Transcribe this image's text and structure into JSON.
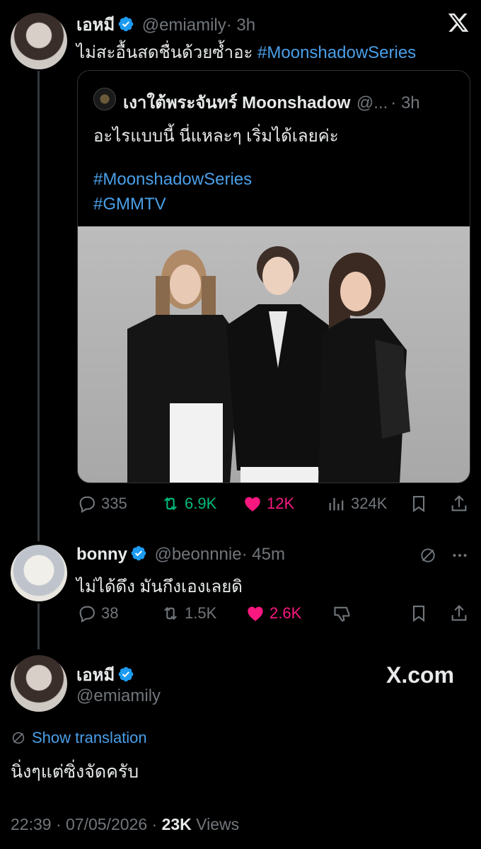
{
  "tweet1": {
    "name": "เอหมี",
    "handle": "@emiamily",
    "time": "· 3h",
    "text": "ไม่สะอื้นสดชื่นด้วยซ้ำอะ",
    "hashtag": "#MoonshadowSeries"
  },
  "quote": {
    "name": "เงาใต้พระจันทร์ Moonshadow",
    "handle": "@...",
    "time": "· 3h",
    "text": "อะไรแบบนี้ นี่แหละๆ เริ่มได้เลยค่ะ",
    "hashtag1": "#MoonshadowSeries",
    "hashtag2": "#GMMTV"
  },
  "tweet1_actions": {
    "replies": "335",
    "retweets": "6.9K",
    "likes": "12K",
    "views": "324K"
  },
  "tweet2": {
    "name": "bonny",
    "handle": "@beonnnie",
    "time": "· 45m",
    "text": "ไม่ได้ดึง มันกึงเองเลยดิ"
  },
  "tweet2_actions": {
    "replies": "38",
    "retweets": "1.5K",
    "likes": "2.6K"
  },
  "main": {
    "name": "เอหมี",
    "handle": "@emiamily",
    "brand": "X.com",
    "show_translation": "Show translation",
    "text": "นิ่งๆแต่ซิ่งจัดครับ",
    "time": "22:39 · 07/05/2026 ·",
    "views_count": "23K",
    "views_label": "Views"
  },
  "colors": {
    "background": "#000000",
    "link": "#4a9fe8",
    "retweet_active": "#00ba7c",
    "like_active": "#f91880",
    "verified": "#1d9bf0"
  }
}
